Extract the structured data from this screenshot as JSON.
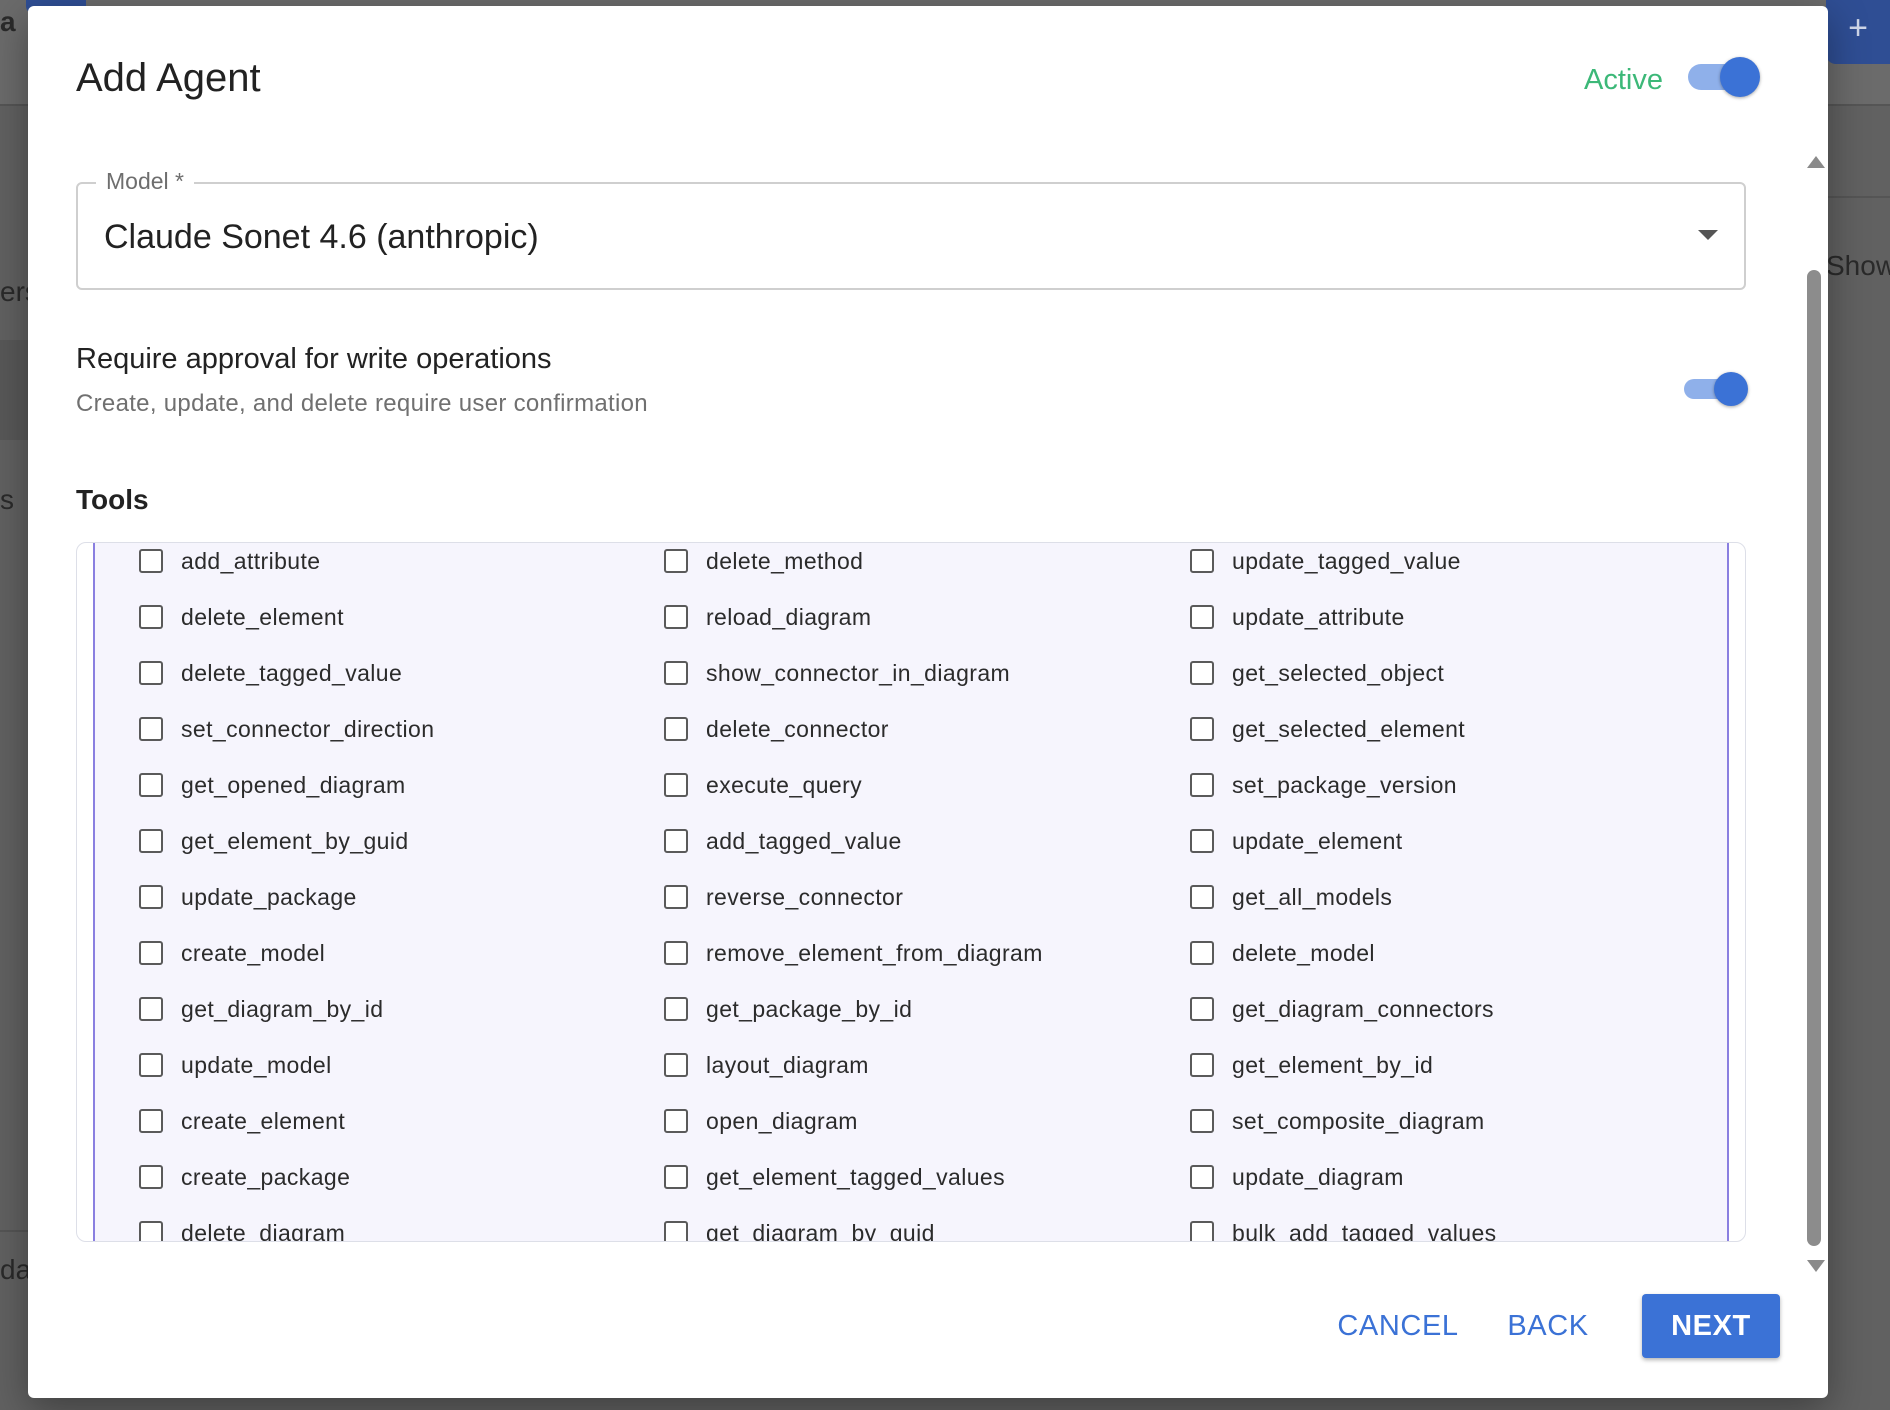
{
  "background": {
    "left_text_1": "ers",
    "left_text_2": "s",
    "left_text_3": "da",
    "right_text": "Show",
    "top_left_text": "a",
    "fab_label": "+"
  },
  "dialog": {
    "title": "Add Agent",
    "active_label": "Active",
    "active_on": true
  },
  "model": {
    "label": "Model *",
    "value": "Claude Sonet 4.6 (anthropic)"
  },
  "approval": {
    "title": "Require approval for write operations",
    "subtitle": "Create, update, and delete require user confirmation",
    "enabled": true
  },
  "tools": {
    "heading": "Tools",
    "columns": [
      [
        "add_attribute",
        "delete_element",
        "delete_tagged_value",
        "set_connector_direction",
        "get_opened_diagram",
        "get_element_by_guid",
        "update_package",
        "create_model",
        "get_diagram_by_id",
        "update_model",
        "create_element",
        "create_package",
        "delete_diagram"
      ],
      [
        "delete_method",
        "reload_diagram",
        "show_connector_in_diagram",
        "delete_connector",
        "execute_query",
        "add_tagged_value",
        "reverse_connector",
        "remove_element_from_diagram",
        "get_package_by_id",
        "layout_diagram",
        "open_diagram",
        "get_element_tagged_values",
        "get_diagram_by_guid"
      ],
      [
        "update_tagged_value",
        "update_attribute",
        "get_selected_object",
        "get_selected_element",
        "set_package_version",
        "update_element",
        "get_all_models",
        "delete_model",
        "get_diagram_connectors",
        "get_element_by_id",
        "set_composite_diagram",
        "update_diagram",
        "bulk_add_tagged_values"
      ]
    ]
  },
  "actions": {
    "cancel": "CANCEL",
    "back": "BACK",
    "next": "NEXT"
  },
  "colors": {
    "primary": "#3b72d6",
    "active_green": "#3cb878",
    "tools_accent": "#8a7fe0"
  }
}
